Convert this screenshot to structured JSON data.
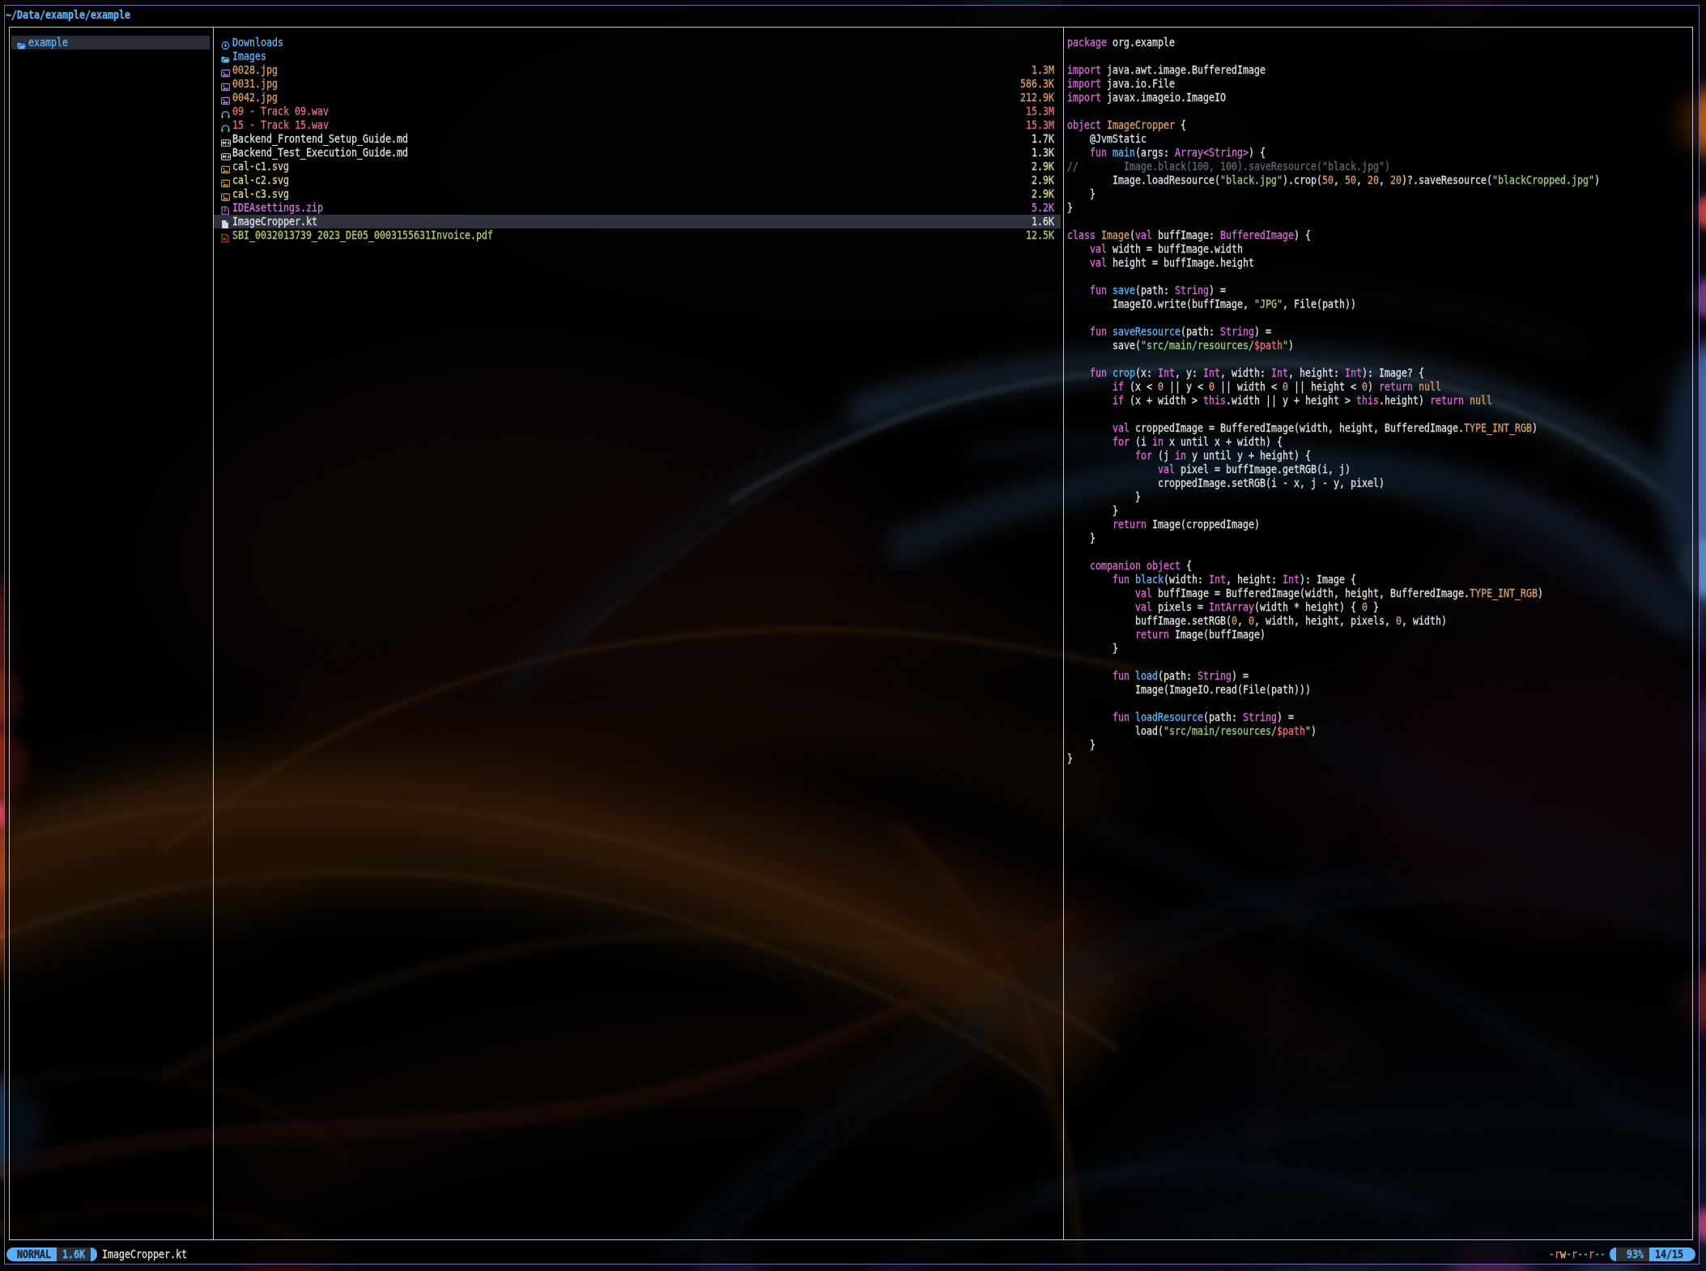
{
  "window": {
    "path_prefix": "~",
    "path_rest": "/Data/example/example",
    "border_color": "#7b60b0"
  },
  "colors": {
    "blue": "#5caef2",
    "cyan": "#56b6c2",
    "pink": "#d268cc",
    "orange": "#d19a66",
    "green": "#98c379",
    "red": "#e06c75",
    "white": "#d7dae0",
    "gray": "#5d6673",
    "khaki": "#d7ce93",
    "olive": "#b3c16d",
    "violet": "#c678dd",
    "panel_border": "#bcc1da",
    "select_bg": "#2e323d",
    "parent_select_bg": "#272c37",
    "status_dark_bg": "#2b2f38",
    "status_text_dark": "#1d232e"
  },
  "parent_pane": {
    "items": [
      {
        "name": "example",
        "icon": "folder-open",
        "color": "blue",
        "selected": true
      }
    ]
  },
  "files_pane": {
    "selected_index": 13,
    "items": [
      {
        "icon": "folder-download",
        "icon_color": "#5caef2",
        "name": "Downloads",
        "size": "",
        "color": "blue"
      },
      {
        "icon": "folder-open",
        "icon_color": "#5caef2",
        "name": "Images",
        "size": "",
        "color": "blue"
      },
      {
        "icon": "image",
        "icon_color": "#a87fe0",
        "name": "0028.jpg",
        "size": "1.3M",
        "color": "orange"
      },
      {
        "icon": "image",
        "icon_color": "#a87fe0",
        "name": "0031.jpg",
        "size": "586.3K",
        "color": "orange"
      },
      {
        "icon": "image",
        "icon_color": "#a87fe0",
        "name": "0042.jpg",
        "size": "212.9K",
        "color": "orange"
      },
      {
        "icon": "headphones",
        "icon_color": "#56b6c2",
        "name": "09 - Track 09.wav",
        "size": "15.3M",
        "color": "red"
      },
      {
        "icon": "headphones",
        "icon_color": "#56b6c2",
        "name": "15 - Track 15.wav",
        "size": "15.3M",
        "color": "red"
      },
      {
        "icon": "markdown",
        "icon_color": "#d7dae0",
        "name": "Backend_Frontend_Setup_Guide.md",
        "size": "1.7K",
        "color": "white"
      },
      {
        "icon": "markdown",
        "icon_color": "#d7dae0",
        "name": "Backend_Test_Execution_Guide.md",
        "size": "1.3K",
        "color": "white"
      },
      {
        "icon": "image",
        "icon_color": "#c8963e",
        "name": "cal-c1.svg",
        "size": "2.9K",
        "color": "khaki"
      },
      {
        "icon": "image",
        "icon_color": "#c8963e",
        "name": "cal-c2.svg",
        "size": "2.9K",
        "color": "khaki"
      },
      {
        "icon": "image",
        "icon_color": "#c8963e",
        "name": "cal-c3.svg",
        "size": "2.9K",
        "color": "khaki"
      },
      {
        "icon": "zip",
        "icon_color": "#c678dd",
        "name": "IDEAsettings.zip",
        "size": "5.2K",
        "color": "violet"
      },
      {
        "icon": "file",
        "icon_color": "#d7dae0",
        "name": "ImageCropper.kt",
        "size": "1.6K",
        "color": "white"
      },
      {
        "icon": "pdf",
        "icon_color": "#cc3e36",
        "name": "SBI_0032013739_2023_DE05_0003155631Invoice.pdf",
        "size": "12.5K",
        "color": "olive"
      }
    ]
  },
  "preview_pane": {
    "filename": "ImageCropper.kt",
    "lines": [
      [
        [
          "k",
          "package"
        ],
        [
          "w",
          " org.example"
        ]
      ],
      [],
      [
        [
          "k",
          "import"
        ],
        [
          "w",
          " java.awt.image.BufferedImage"
        ]
      ],
      [
        [
          "k",
          "import"
        ],
        [
          "w",
          " java.io.File"
        ]
      ],
      [
        [
          "k",
          "import"
        ],
        [
          "w",
          " javax.imageio.ImageIO"
        ]
      ],
      [],
      [
        [
          "k",
          "object"
        ],
        [
          "w",
          " "
        ],
        [
          "n",
          "ImageCropper"
        ],
        [
          "w",
          " {"
        ]
      ],
      [
        [
          "w",
          "    @JvmStatic"
        ]
      ],
      [
        [
          "w",
          "    "
        ],
        [
          "k",
          "fun"
        ],
        [
          "w",
          " "
        ],
        [
          "f",
          "main"
        ],
        [
          "w",
          "(args: "
        ],
        [
          "k",
          "Array<String>"
        ],
        [
          "w",
          ") {"
        ]
      ],
      [
        [
          "c",
          "//        Image.black(100, 100).saveResource(\"black.jpg\")"
        ]
      ],
      [
        [
          "w",
          "        Image.loadResource("
        ],
        [
          "s",
          "\"black.jpg\""
        ],
        [
          "w",
          ").crop("
        ],
        [
          "n",
          "50"
        ],
        [
          "w",
          ", "
        ],
        [
          "n",
          "50"
        ],
        [
          "w",
          ", "
        ],
        [
          "n",
          "20"
        ],
        [
          "w",
          ", "
        ],
        [
          "n",
          "20"
        ],
        [
          "w",
          ")?.saveResource("
        ],
        [
          "s",
          "\"blackCropped.jpg\""
        ],
        [
          "w",
          ")"
        ]
      ],
      [
        [
          "w",
          "    }"
        ]
      ],
      [
        [
          "w",
          "}"
        ]
      ],
      [],
      [
        [
          "k",
          "class"
        ],
        [
          "w",
          " "
        ],
        [
          "n",
          "Image"
        ],
        [
          "w",
          "("
        ],
        [
          "k",
          "val"
        ],
        [
          "w",
          " buffImage: "
        ],
        [
          "k",
          "BufferedImage"
        ],
        [
          "w",
          ") {"
        ]
      ],
      [
        [
          "w",
          "    "
        ],
        [
          "k",
          "val"
        ],
        [
          "w",
          " width = buffImage.width"
        ]
      ],
      [
        [
          "w",
          "    "
        ],
        [
          "k",
          "val"
        ],
        [
          "w",
          " height = buffImage.height"
        ]
      ],
      [],
      [
        [
          "w",
          "    "
        ],
        [
          "k",
          "fun"
        ],
        [
          "w",
          " "
        ],
        [
          "f",
          "save"
        ],
        [
          "w",
          "(path: "
        ],
        [
          "k",
          "String"
        ],
        [
          "w",
          ") ="
        ]
      ],
      [
        [
          "w",
          "        ImageIO.write(buffImage, "
        ],
        [
          "s",
          "\"JPG\""
        ],
        [
          "w",
          ", File(path))"
        ]
      ],
      [],
      [
        [
          "w",
          "    "
        ],
        [
          "k",
          "fun"
        ],
        [
          "w",
          " "
        ],
        [
          "f",
          "saveResource"
        ],
        [
          "w",
          "(path: "
        ],
        [
          "k",
          "String"
        ],
        [
          "w",
          ") ="
        ]
      ],
      [
        [
          "w",
          "        save("
        ],
        [
          "s",
          "\"src/main/resources/"
        ],
        [
          "r",
          "$path"
        ],
        [
          "s",
          "\""
        ],
        [
          "w",
          ")"
        ]
      ],
      [],
      [
        [
          "w",
          "    "
        ],
        [
          "k",
          "fun"
        ],
        [
          "w",
          " "
        ],
        [
          "f",
          "crop"
        ],
        [
          "w",
          "(x: "
        ],
        [
          "k",
          "Int"
        ],
        [
          "w",
          ", y: "
        ],
        [
          "k",
          "Int"
        ],
        [
          "w",
          ", width: "
        ],
        [
          "k",
          "Int"
        ],
        [
          "w",
          ", height: "
        ],
        [
          "k",
          "Int"
        ],
        [
          "w",
          "): Image? {"
        ]
      ],
      [
        [
          "w",
          "        "
        ],
        [
          "k",
          "if"
        ],
        [
          "w",
          " (x < "
        ],
        [
          "n",
          "0"
        ],
        [
          "w",
          " || y < "
        ],
        [
          "n",
          "0"
        ],
        [
          "w",
          " || width < "
        ],
        [
          "n",
          "0"
        ],
        [
          "w",
          " || height < "
        ],
        [
          "n",
          "0"
        ],
        [
          "w",
          ") "
        ],
        [
          "k",
          "return"
        ],
        [
          "w",
          " "
        ],
        [
          "n",
          "null"
        ]
      ],
      [
        [
          "w",
          "        "
        ],
        [
          "k",
          "if"
        ],
        [
          "w",
          " (x + width > "
        ],
        [
          "k",
          "this"
        ],
        [
          "w",
          ".width || y + height > "
        ],
        [
          "k",
          "this"
        ],
        [
          "w",
          ".height) "
        ],
        [
          "k",
          "return"
        ],
        [
          "w",
          " "
        ],
        [
          "n",
          "null"
        ]
      ],
      [],
      [
        [
          "w",
          "        "
        ],
        [
          "k",
          "val"
        ],
        [
          "w",
          " croppedImage = BufferedImage(width, height, BufferedImage."
        ],
        [
          "n",
          "TYPE_INT_RGB"
        ],
        [
          "w",
          ")"
        ]
      ],
      [
        [
          "w",
          "        "
        ],
        [
          "k",
          "for"
        ],
        [
          "w",
          " (i "
        ],
        [
          "k",
          "in"
        ],
        [
          "w",
          " x until x + width) {"
        ]
      ],
      [
        [
          "w",
          "            "
        ],
        [
          "k",
          "for"
        ],
        [
          "w",
          " (j "
        ],
        [
          "k",
          "in"
        ],
        [
          "w",
          " y until y + height) {"
        ]
      ],
      [
        [
          "w",
          "                "
        ],
        [
          "k",
          "val"
        ],
        [
          "w",
          " pixel = buffImage.getRGB(i, j)"
        ]
      ],
      [
        [
          "w",
          "                croppedImage.setRGB(i - x, j - y, pixel)"
        ]
      ],
      [
        [
          "w",
          "            }"
        ]
      ],
      [
        [
          "w",
          "        }"
        ]
      ],
      [
        [
          "w",
          "        "
        ],
        [
          "k",
          "return"
        ],
        [
          "w",
          " Image(croppedImage)"
        ]
      ],
      [
        [
          "w",
          "    }"
        ]
      ],
      [],
      [
        [
          "w",
          "    "
        ],
        [
          "k",
          "companion"
        ],
        [
          "w",
          " "
        ],
        [
          "k",
          "object"
        ],
        [
          "w",
          " {"
        ]
      ],
      [
        [
          "w",
          "        "
        ],
        [
          "k",
          "fun"
        ],
        [
          "w",
          " "
        ],
        [
          "f",
          "black"
        ],
        [
          "w",
          "(width: "
        ],
        [
          "k",
          "Int"
        ],
        [
          "w",
          ", height: "
        ],
        [
          "k",
          "Int"
        ],
        [
          "w",
          "): Image {"
        ]
      ],
      [
        [
          "w",
          "            "
        ],
        [
          "k",
          "val"
        ],
        [
          "w",
          " buffImage = BufferedImage(width, height, BufferedImage."
        ],
        [
          "n",
          "TYPE_INT_RGB"
        ],
        [
          "w",
          ")"
        ]
      ],
      [
        [
          "w",
          "            "
        ],
        [
          "k",
          "val"
        ],
        [
          "w",
          " pixels = "
        ],
        [
          "k",
          "IntArray"
        ],
        [
          "w",
          "(width * height) { "
        ],
        [
          "n",
          "0"
        ],
        [
          "w",
          " }"
        ]
      ],
      [
        [
          "w",
          "            buffImage.setRGB("
        ],
        [
          "n",
          "0"
        ],
        [
          "w",
          ", "
        ],
        [
          "n",
          "0"
        ],
        [
          "w",
          ", width, height, pixels, "
        ],
        [
          "n",
          "0"
        ],
        [
          "w",
          ", width)"
        ]
      ],
      [
        [
          "w",
          "            "
        ],
        [
          "k",
          "return"
        ],
        [
          "w",
          " Image(buffImage)"
        ]
      ],
      [
        [
          "w",
          "        }"
        ]
      ],
      [],
      [
        [
          "w",
          "        "
        ],
        [
          "k",
          "fun"
        ],
        [
          "w",
          " "
        ],
        [
          "f",
          "load"
        ],
        [
          "w",
          "(path: "
        ],
        [
          "k",
          "String"
        ],
        [
          "w",
          ") ="
        ]
      ],
      [
        [
          "w",
          "            Image(ImageIO.read(File(path)))"
        ]
      ],
      [],
      [
        [
          "w",
          "        "
        ],
        [
          "k",
          "fun"
        ],
        [
          "w",
          " "
        ],
        [
          "f",
          "loadResource"
        ],
        [
          "w",
          "(path: "
        ],
        [
          "k",
          "String"
        ],
        [
          "w",
          ") ="
        ]
      ],
      [
        [
          "w",
          "            load("
        ],
        [
          "s",
          "\"src/main/resources/"
        ],
        [
          "r",
          "$path"
        ],
        [
          "s",
          "\""
        ],
        [
          "w",
          ")"
        ]
      ],
      [
        [
          "w",
          "    }"
        ]
      ],
      [
        [
          "w",
          "}"
        ]
      ]
    ]
  },
  "status_bar": {
    "mode": "NORMAL",
    "size": "1.6K",
    "file": "ImageCropper.kt",
    "perms": "-rw-r--r--",
    "percent": "93%",
    "position": "14/15"
  }
}
